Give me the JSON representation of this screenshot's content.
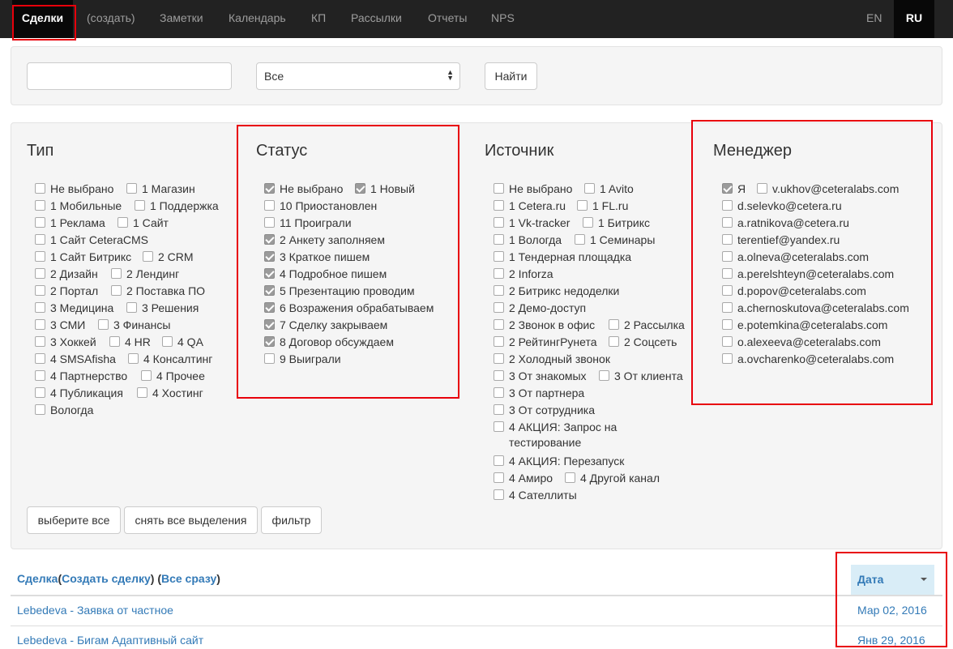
{
  "navbar": {
    "items": [
      "Сделки",
      "(создать)",
      "Заметки",
      "Календарь",
      "КП",
      "Рассылки",
      "Отчеты",
      "NPS"
    ],
    "lang_en": "EN",
    "lang_ru": "RU"
  },
  "search": {
    "input_value": "",
    "input_placeholder": "",
    "select_value": "Все",
    "find_button": "Найти"
  },
  "filters": {
    "type": {
      "title": "Тип",
      "rows": [
        [
          [
            "Не выбрано",
            false
          ],
          [
            "1 Магазин",
            false
          ]
        ],
        [
          [
            "1 Мобильные",
            false
          ],
          [
            "1 Поддержка",
            false
          ]
        ],
        [
          [
            "1 Реклама",
            false
          ],
          [
            "1 Сайт",
            false
          ]
        ],
        [
          [
            "1 Сайт CeteraCMS",
            false
          ]
        ],
        [
          [
            "1 Сайт Битрикс",
            false
          ],
          [
            "2 CRM",
            false
          ]
        ],
        [
          [
            "2 Дизайн",
            false
          ],
          [
            "2 Лендинг",
            false
          ]
        ],
        [
          [
            "2 Портал",
            false
          ],
          [
            "2 Поставка ПО",
            false
          ]
        ],
        [
          [
            "3 Медицина",
            false
          ],
          [
            "3 Решения",
            false
          ]
        ],
        [
          [
            "3 СМИ",
            false
          ],
          [
            "3 Финансы",
            false
          ]
        ],
        [
          [
            "3 Хоккей",
            false
          ],
          [
            "4 HR",
            false
          ],
          [
            "4 QA",
            false
          ]
        ],
        [
          [
            "4 SMSAfisha",
            false
          ],
          [
            "4 Консалтинг",
            false
          ]
        ],
        [
          [
            "4 Партнерство",
            false
          ],
          [
            "4 Прочее",
            false
          ]
        ],
        [
          [
            "4 Публикация",
            false
          ],
          [
            "4 Хостинг",
            false
          ]
        ],
        [
          [
            "Вологда",
            false
          ]
        ]
      ]
    },
    "status": {
      "title": "Статус",
      "rows": [
        [
          [
            "Не выбрано",
            true
          ],
          [
            "1 Новый",
            true
          ]
        ],
        [
          [
            "10 Приостановлен",
            false
          ]
        ],
        [
          [
            "11 Проиграли",
            false
          ]
        ],
        [
          [
            "2 Анкету заполняем",
            true
          ]
        ],
        [
          [
            "3 Краткое пишем",
            true
          ]
        ],
        [
          [
            "4 Подробное пишем",
            true
          ]
        ],
        [
          [
            "5 Презентацию проводим",
            true
          ]
        ],
        [
          [
            "6 Возражения обрабатываем",
            true
          ]
        ],
        [
          [
            "7 Сделку закрываем",
            true
          ]
        ],
        [
          [
            "8 Договор обсуждаем",
            true
          ]
        ],
        [
          [
            "9 Выиграли",
            false
          ]
        ]
      ]
    },
    "source": {
      "title": "Источник",
      "rows": [
        [
          [
            "Не выбрано",
            false
          ],
          [
            "1 Avito",
            false
          ]
        ],
        [
          [
            "1 Cetera.ru",
            false
          ],
          [
            "1 FL.ru",
            false
          ]
        ],
        [
          [
            "1 Vk-tracker",
            false
          ],
          [
            "1 Битрикс",
            false
          ]
        ],
        [
          [
            "1 Вологда",
            false
          ],
          [
            "1 Семинары",
            false
          ]
        ],
        [
          [
            "1 Тендерная площадка",
            false
          ]
        ],
        [
          [
            "2 Inforza",
            false
          ]
        ],
        [
          [
            "2 Битрикс недоделки",
            false
          ]
        ],
        [
          [
            "2 Демо-доступ",
            false
          ]
        ],
        [
          [
            "2 Звонок в офис",
            false
          ],
          [
            "2 Рассылка",
            false
          ]
        ],
        [
          [
            "2 РейтингРунета",
            false
          ],
          [
            "2 Соцсеть",
            false
          ]
        ],
        [
          [
            "2 Холодный звонок",
            false
          ]
        ],
        [
          [
            "3 От знакомых",
            false
          ],
          [
            "3 От клиента",
            false
          ]
        ],
        [
          [
            "3 От партнера",
            false
          ]
        ],
        [
          [
            "3 От сотрудника",
            false
          ]
        ],
        [
          [
            "4 АКЦИЯ: Запрос на",
            false
          ]
        ],
        [
          [
            "4 АКЦИЯ: Перезапуск",
            false
          ]
        ],
        [
          [
            "4 Амиро",
            false
          ],
          [
            "4 Другой канал",
            false
          ]
        ],
        [
          [
            "4 Сателлиты",
            false
          ]
        ]
      ],
      "wrap_text": "тестирование"
    },
    "manager": {
      "title": "Менеджер",
      "rows": [
        [
          [
            "Я",
            true
          ],
          [
            "v.ukhov@ceteralabs.com",
            false
          ]
        ],
        [
          [
            "d.selevko@cetera.ru",
            false
          ]
        ],
        [
          [
            "a.ratnikova@cetera.ru",
            false
          ]
        ],
        [
          [
            "terentief@yandex.ru",
            false
          ]
        ],
        [
          [
            "a.olneva@ceteralabs.com",
            false
          ]
        ],
        [
          [
            "a.perelshteyn@ceteralabs.com",
            false
          ]
        ],
        [
          [
            "d.popov@ceteralabs.com",
            false
          ]
        ],
        [
          [
            "a.chernoskutova@ceteralabs.com",
            false
          ]
        ],
        [
          [
            "e.potemkina@ceteralabs.com",
            false
          ]
        ],
        [
          [
            "o.alexeeva@ceteralabs.com",
            false
          ]
        ],
        [
          [
            "a.ovcharenko@ceteralabs.com",
            false
          ]
        ]
      ]
    },
    "buttons": {
      "select_all": "выберите все",
      "deselect_all": "снять все выделения",
      "filter": "фильтр"
    }
  },
  "table": {
    "header_deal": "Сделка",
    "header_open": "(",
    "header_create": "Создать сделку",
    "header_mid": ") (",
    "header_all": "Все сразу",
    "header_close": ")",
    "header_date": "Дата",
    "rows": [
      {
        "deal": "Lebedeva - Заявка от частное",
        "date": "Мар 02, 2016"
      },
      {
        "deal": "Lebedeva - Бигам Адаптивный сайт",
        "date": "Янв 29, 2016"
      }
    ]
  }
}
